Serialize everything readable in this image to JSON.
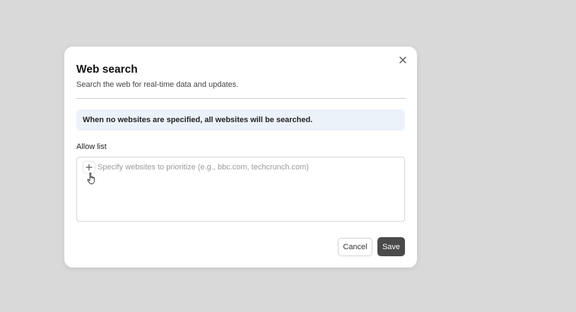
{
  "dialog": {
    "title": "Web search",
    "subtitle": "Search the web for real-time data and updates.",
    "close_icon": "close-icon"
  },
  "notice": {
    "text": "When no websites are specified, all websites will be searched."
  },
  "allow_list": {
    "label": "Allow list",
    "add_icon": "plus-icon",
    "value": "",
    "placeholder": "Specify websites to prioritize (e.g., bbc.com, techcrunch.com)"
  },
  "footer": {
    "cancel_label": "Cancel",
    "save_label": "Save"
  },
  "colors": {
    "backdrop": "#d9d9d9",
    "notice_bg": "#ebf2f9",
    "primary_button": "#4a4a4a"
  }
}
